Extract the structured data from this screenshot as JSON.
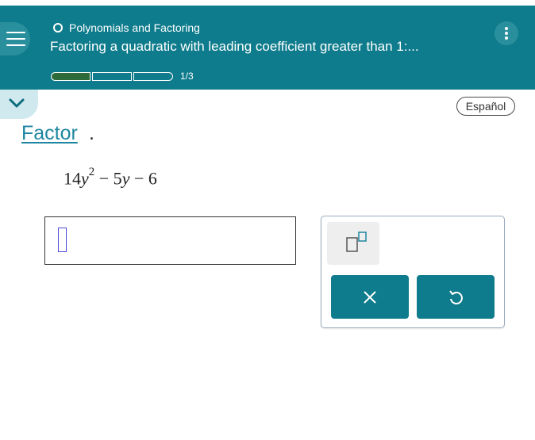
{
  "header": {
    "topic": "Polynomials and Factoring",
    "subtitle": "Factoring a quadratic with leading coefficient greater than 1:...",
    "progress": {
      "current": 1,
      "total": 3,
      "label": "1/3"
    },
    "menu_icon": "hamburger-menu-icon",
    "more_icon": "more-vertical-icon"
  },
  "language_button": "Español",
  "question": {
    "instruction": "Factor",
    "instruction_punct": ".",
    "expression": {
      "coef": "14",
      "var": "y",
      "exp": "2",
      "rest_op1": " − 5",
      "rest_var": "y",
      "rest_op2": " − 6"
    }
  },
  "answer": {
    "value": ""
  },
  "keypad": {
    "exponent_icon": "exponent-template-icon",
    "clear_icon": "clear-x-icon",
    "undo_icon": "undo-icon"
  },
  "colors": {
    "header_bg": "#0e7c8c",
    "accent": "#1f86a1",
    "progress_fill": "#2e6b3a"
  }
}
